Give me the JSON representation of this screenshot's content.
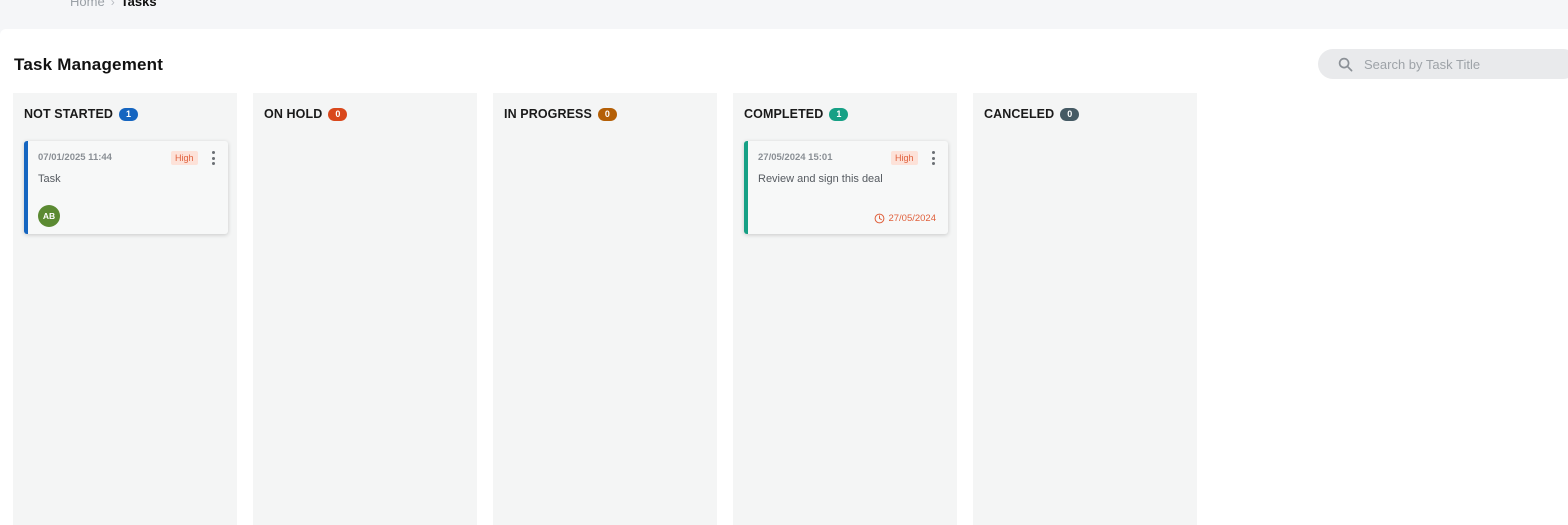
{
  "breadcrumb": {
    "home": "Home",
    "separator": "›",
    "current": "Tasks"
  },
  "page": {
    "title": "Task Management"
  },
  "search": {
    "placeholder": "Search by Task Title",
    "icon": "search-icon"
  },
  "columns": [
    {
      "title": "NOT STARTED",
      "count": "1",
      "color": "#1565c0"
    },
    {
      "title": "ON HOLD",
      "count": "0",
      "color": "#d9481c"
    },
    {
      "title": "IN PROGRESS",
      "count": "0",
      "color": "#b45f06"
    },
    {
      "title": "COMPLETED",
      "count": "1",
      "color": "#16a085"
    },
    {
      "title": "CANCELED",
      "count": "0",
      "color": "#455a64"
    }
  ],
  "cards": {
    "not_started": [
      {
        "date": "07/01/2025 11:44",
        "priority": "High",
        "title": "Task",
        "assignee_initials": "AB",
        "accent": "#1565c0"
      }
    ],
    "completed": [
      {
        "date": "27/05/2024 15:01",
        "priority": "High",
        "title": "Review and sign this deal",
        "due_date": "27/05/2024",
        "accent": "#16a085"
      }
    ]
  },
  "colors": {
    "priority_high": "#e0603c",
    "priority_high_bg": "#fde2d9",
    "avatar": "#5b8a32"
  }
}
